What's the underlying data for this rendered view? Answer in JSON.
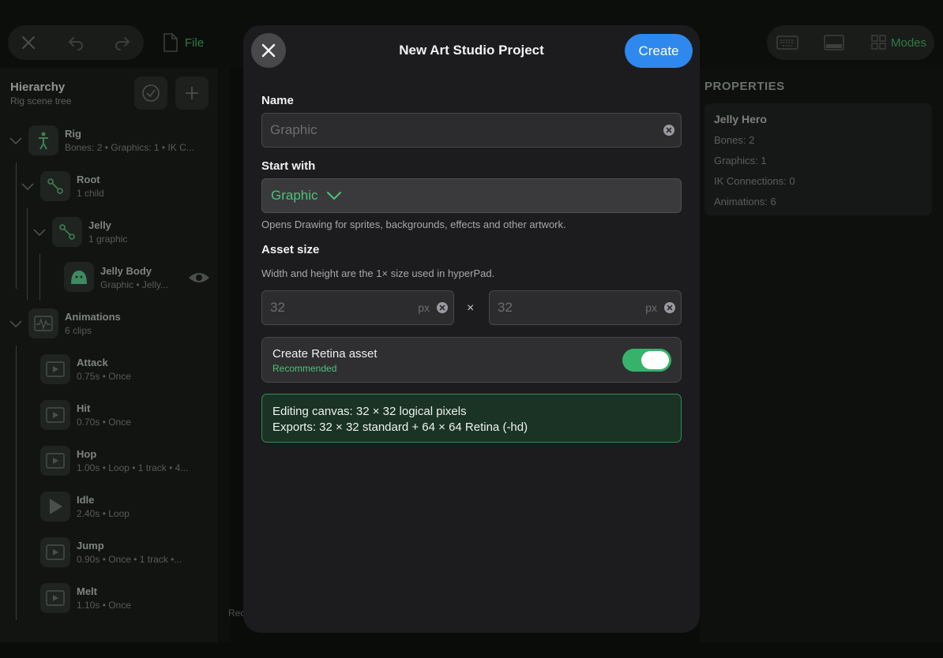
{
  "toolbar": {
    "file_label": "File",
    "modes_label": "Modes"
  },
  "hierarchy": {
    "title": "Hierarchy",
    "subtitle": "Rig scene tree",
    "nodes": [
      {
        "title": "Rig",
        "sub": "Bones: 2  •  Graphics: 1  •  IK C..."
      },
      {
        "title": "Root",
        "sub": "1 child"
      },
      {
        "title": "Jelly",
        "sub": "1 graphic"
      },
      {
        "title": "Jelly Body",
        "sub": "Graphic  •  Jelly..."
      },
      {
        "title": "Animations",
        "sub": "6 clips"
      },
      {
        "title": "Attack",
        "sub": "0.75s  •  Once"
      },
      {
        "title": "Hit",
        "sub": "0.70s  •  Once"
      },
      {
        "title": "Hop",
        "sub": "1.00s  •  Loop  •  1 track  •  4..."
      },
      {
        "title": "Idle",
        "sub": "2.40s  •  Loop"
      },
      {
        "title": "Jump",
        "sub": "0.90s  •  Once  •  1 track  •..."
      },
      {
        "title": "Melt",
        "sub": "1.10s  •  Once"
      }
    ]
  },
  "center": {
    "rec_label": "Rec"
  },
  "properties": {
    "heading": "PROPERTIES",
    "card_title": "Jelly Hero",
    "lines": [
      "Bones: 2",
      "Graphics: 1",
      "IK Connections: 0",
      "Animations: 6"
    ]
  },
  "modal": {
    "title": "New Art Studio Project",
    "create_label": "Create",
    "name_label": "Name",
    "name_placeholder": "Graphic",
    "start_label": "Start with",
    "start_value": "Graphic",
    "start_hint": "Opens Drawing for sprites, backgrounds, effects and other artwork.",
    "asset_label": "Asset size",
    "asset_hint": "Width and height are the 1× size used in hyperPad.",
    "width_placeholder": "32",
    "height_placeholder": "32",
    "unit": "px",
    "times": "×",
    "retina_title": "Create Retina asset",
    "retina_sub": "Recommended",
    "retina_on": true,
    "info_line1": "Editing canvas: 32 × 32 logical pixels",
    "info_line2": "Exports: 32 × 32 standard + 64 × 64 Retina (-hd)"
  },
  "colors": {
    "accent_green": "#4cc27a",
    "create_blue": "#2f88ee",
    "toggle_green": "#37b26a"
  }
}
